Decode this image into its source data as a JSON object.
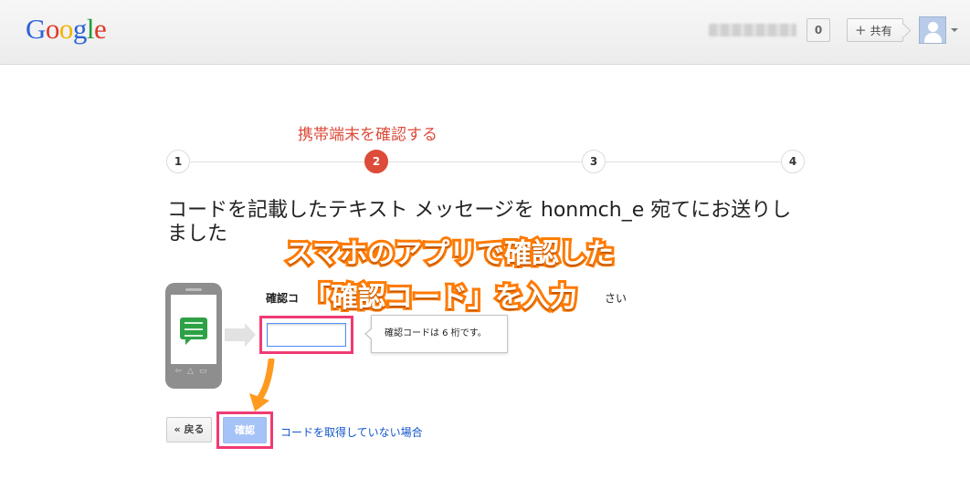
{
  "header": {
    "logo_letters": [
      {
        "ch": "G",
        "color": "#2d63d6"
      },
      {
        "ch": "o",
        "color": "#dd3b2a"
      },
      {
        "ch": "o",
        "color": "#f2b400"
      },
      {
        "ch": "g",
        "color": "#2d63d6"
      },
      {
        "ch": "l",
        "color": "#1a9f3a"
      },
      {
        "ch": "e",
        "color": "#dd3b2a"
      }
    ],
    "notification_count": "0",
    "share_label": "共有",
    "share_plus": "+"
  },
  "stepper": {
    "title": "携帯端末を確認する",
    "steps": [
      "1",
      "2",
      "3",
      "4"
    ],
    "active_index": 1
  },
  "heading": "コードを記載したテキスト メッセージを honmch_e 宛てにお送りしました",
  "form": {
    "code_label": "確認コ",
    "code_label_tail": "さい",
    "code_value": "",
    "tooltip": "確認コードは 6 桁です。"
  },
  "overlay": {
    "line1": "スマホのアプリで確認した",
    "line2": "「確認コード」を入力"
  },
  "actions": {
    "back_label": "« 戻る",
    "confirm_label": "確認",
    "no_code_link": "コードを取得していない場合"
  },
  "colors": {
    "accent_red": "#dd4b39",
    "highlight_pink": "#f03a73",
    "annotation_orange": "#ff7a00",
    "link_blue": "#1155cc"
  }
}
